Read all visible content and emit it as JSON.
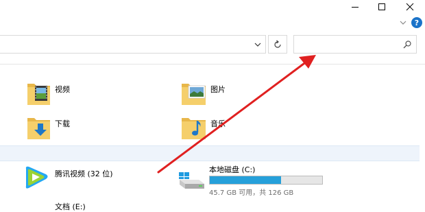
{
  "window": {
    "controls": [
      "minimize",
      "maximize",
      "close"
    ]
  },
  "ribbon": {
    "help_label": "?"
  },
  "address_bar": {
    "path": ""
  },
  "search": {
    "placeholder": ""
  },
  "folders": [
    {
      "label": "视频",
      "icon": "videos-folder-icon"
    },
    {
      "label": "图片",
      "icon": "pictures-folder-icon"
    },
    {
      "label": "下载",
      "icon": "downloads-folder-icon"
    },
    {
      "label": "音乐",
      "icon": "music-folder-icon"
    }
  ],
  "devices": [
    {
      "label": "腾讯视频 (32 位)",
      "icon": "tencent-video-icon"
    },
    {
      "label": "本地磁盘 (C:)",
      "icon": "local-disk-icon",
      "usage_text": "45.7 GB 可用，共 126 GB",
      "used_fraction": 0.637
    },
    {
      "label": "文档 (E:)",
      "icon": "drive-icon"
    }
  ],
  "colors": {
    "accent": "#26a0da",
    "annotation_arrow": "#e02020",
    "group_band": "#eef4fb",
    "help_badge": "#1a73c9"
  }
}
